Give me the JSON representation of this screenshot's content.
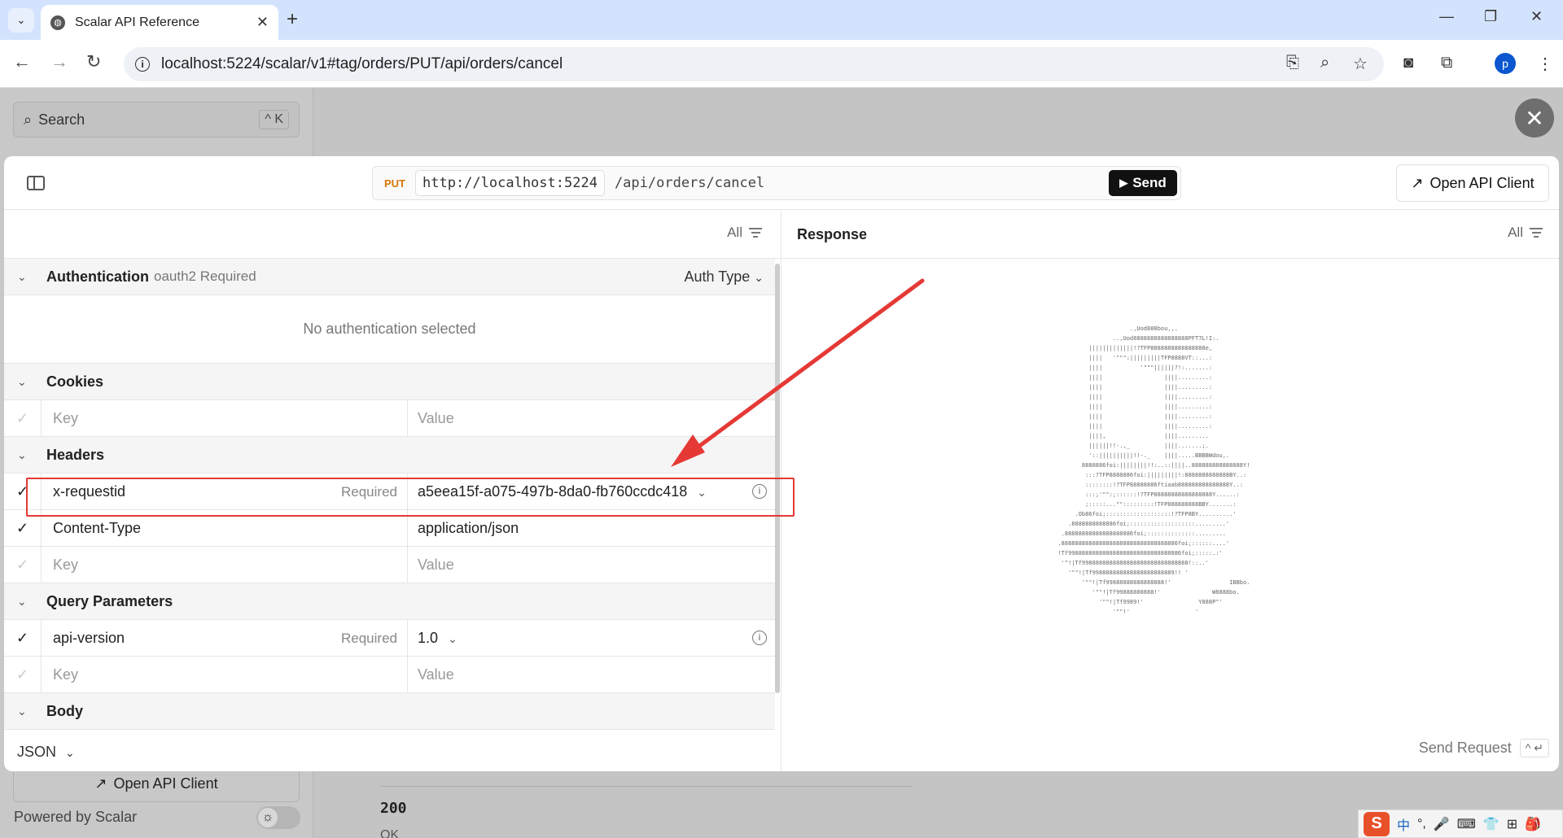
{
  "browser": {
    "tab_title": "Scalar API Reference",
    "url": "localhost:5224/scalar/v1#tag/orders/PUT/api/orders/cancel",
    "profile_initial": "p"
  },
  "background": {
    "search_placeholder": "Search",
    "search_shortcut": "^ K",
    "open_client_label": "Open API Client",
    "powered_by": "Powered by Scalar",
    "status_code": "200",
    "status_text": "OK"
  },
  "request": {
    "method": "PUT",
    "server": "http://localhost:5224",
    "path": "/api/orders/cancel",
    "send_label": "Send",
    "open_client_label": "Open API Client"
  },
  "left_panel": {
    "filter_label": "All",
    "authentication": {
      "title": "Authentication",
      "subtitle": "oauth2 Required",
      "auth_type_label": "Auth Type",
      "empty_text": "No authentication selected"
    },
    "cookies": {
      "title": "Cookies",
      "key_placeholder": "Key",
      "value_placeholder": "Value"
    },
    "headers": {
      "title": "Headers",
      "rows": [
        {
          "key": "x-requestid",
          "required": "Required",
          "value": "a5eea15f-a075-497b-8da0-fb760ccdc418"
        },
        {
          "key": "Content-Type",
          "value": "application/json"
        }
      ],
      "key_placeholder": "Key",
      "value_placeholder": "Value"
    },
    "query": {
      "title": "Query Parameters",
      "rows": [
        {
          "key": "api-version",
          "required": "Required",
          "value": "1.0"
        }
      ],
      "key_placeholder": "Key",
      "value_placeholder": "Value"
    },
    "body": {
      "title": "Body",
      "format": "JSON"
    }
  },
  "right_panel": {
    "title": "Response",
    "filter_label": "All",
    "send_request_label": "Send Request",
    "send_shortcut": "^ ↵"
  },
  "ime": {
    "logo": "S",
    "items": [
      "中",
      "°,",
      "🎤",
      "⌨",
      "👕",
      "⊞",
      "🎒"
    ]
  },
  "colors": {
    "method_put": "#d97706",
    "annotation": "#e53935",
    "send_button": "#111111"
  }
}
